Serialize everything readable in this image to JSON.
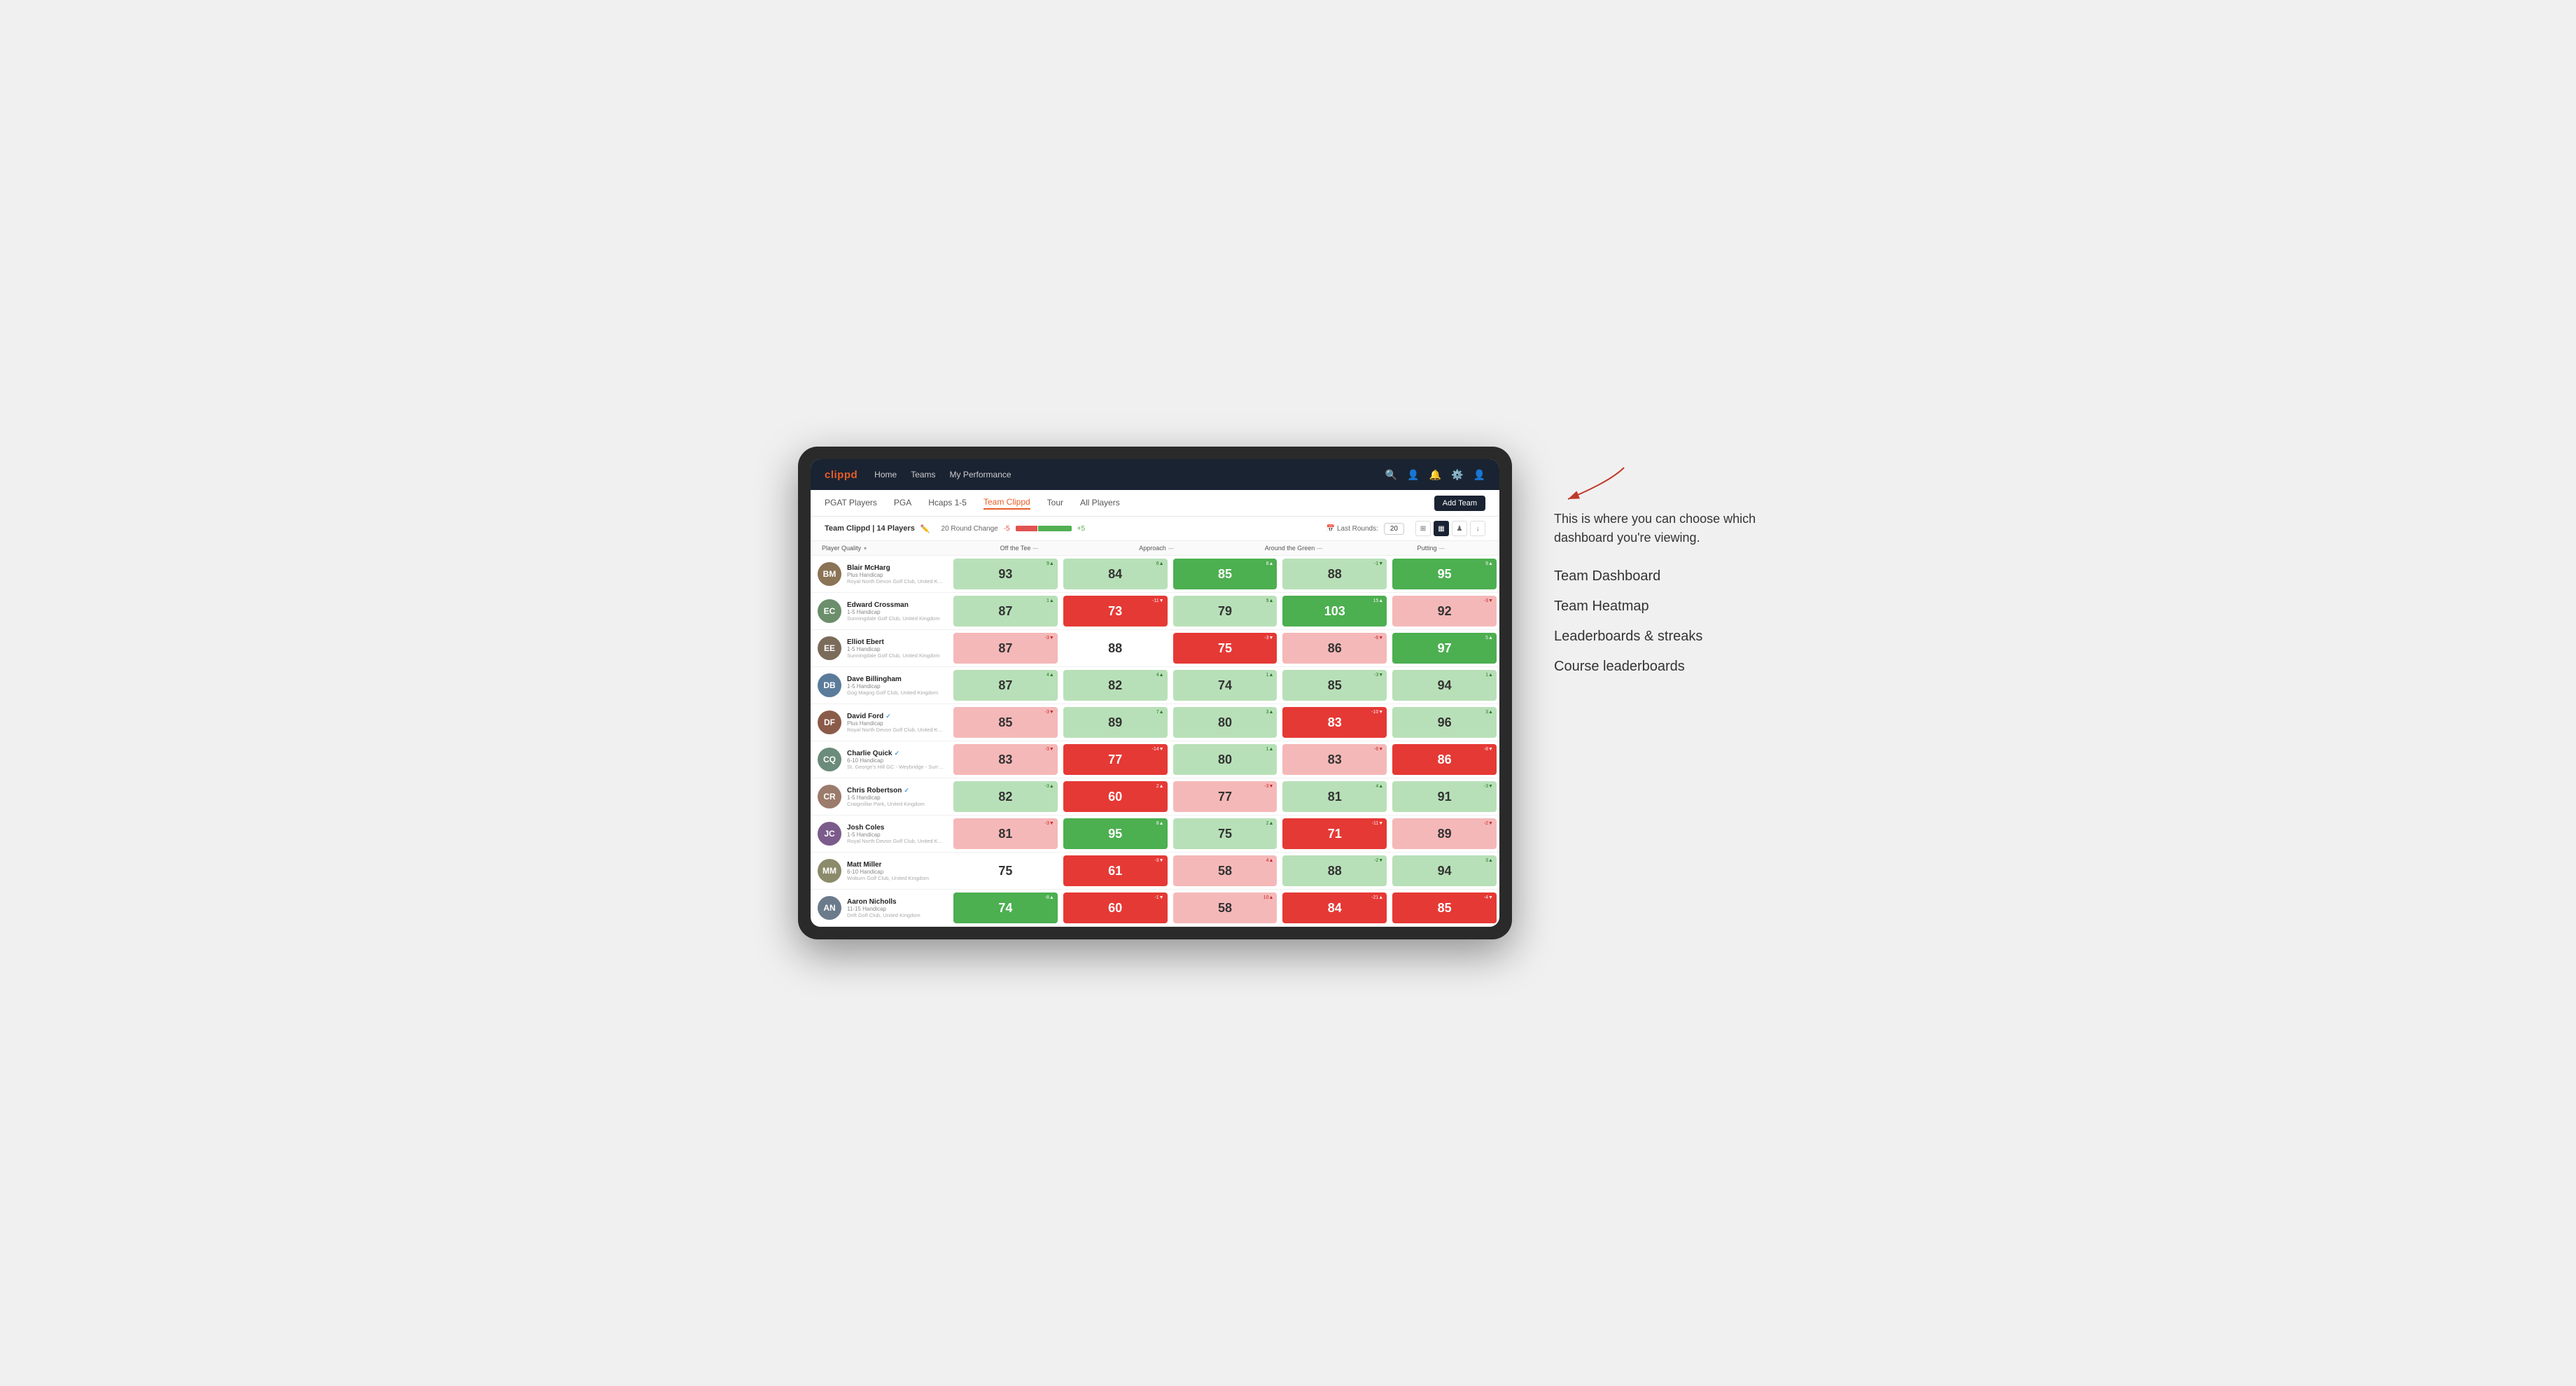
{
  "app": {
    "logo": "clippd",
    "nav_links": [
      "Home",
      "Teams",
      "My Performance"
    ],
    "sub_nav_links": [
      "PGAT Players",
      "PGA",
      "Hcaps 1-5",
      "Team Clippd",
      "Tour",
      "All Players"
    ],
    "active_sub_nav": "Team Clippd",
    "add_team_label": "Add Team"
  },
  "team": {
    "name": "Team Clippd",
    "player_count": "14 Players",
    "round_change_label": "20 Round Change",
    "round_change_neg": "-5",
    "round_change_pos": "+5",
    "last_rounds_label": "Last Rounds:",
    "last_rounds_value": "20"
  },
  "table": {
    "columns": {
      "player_quality": "Player Quality ▾",
      "off_the_tee": "Off the Tee —",
      "approach": "Approach —",
      "around_the_green": "Around the Green —",
      "putting": "Putting —"
    },
    "players": [
      {
        "name": "Blair McHarg",
        "handicap": "Plus Handicap",
        "club": "Royal North Devon Golf Club, United Kingdom",
        "avatar_color": "#8B7355",
        "initials": "BM",
        "scores": [
          {
            "value": "93",
            "change": "9▲",
            "bg": "light-green"
          },
          {
            "value": "84",
            "change": "6▲",
            "bg": "light-green"
          },
          {
            "value": "85",
            "change": "8▲",
            "bg": "green"
          },
          {
            "value": "88",
            "change": "-1▼",
            "bg": "light-green"
          },
          {
            "value": "95",
            "change": "9▲",
            "bg": "green"
          }
        ]
      },
      {
        "name": "Edward Crossman",
        "handicap": "1-5 Handicap",
        "club": "Sunningdale Golf Club, United Kingdom",
        "avatar_color": "#6B8E6B",
        "initials": "EC",
        "scores": [
          {
            "value": "87",
            "change": "1▲",
            "bg": "light-green"
          },
          {
            "value": "73",
            "change": "-11▼",
            "bg": "red"
          },
          {
            "value": "79",
            "change": "9▲",
            "bg": "light-green"
          },
          {
            "value": "103",
            "change": "15▲",
            "bg": "green"
          },
          {
            "value": "92",
            "change": "-3▼",
            "bg": "light-red"
          }
        ]
      },
      {
        "name": "Elliot Ebert",
        "handicap": "1-5 Handicap",
        "club": "Sunningdale Golf Club, United Kingdom",
        "avatar_color": "#7B6B5A",
        "initials": "EE",
        "scores": [
          {
            "value": "87",
            "change": "-3▼",
            "bg": "light-red"
          },
          {
            "value": "88",
            "change": "",
            "bg": "white"
          },
          {
            "value": "75",
            "change": "-3▼",
            "bg": "red"
          },
          {
            "value": "86",
            "change": "-6▼",
            "bg": "light-red"
          },
          {
            "value": "97",
            "change": "5▲",
            "bg": "green"
          }
        ]
      },
      {
        "name": "Dave Billingham",
        "handicap": "1-5 Handicap",
        "club": "Gog Magog Golf Club, United Kingdom",
        "avatar_color": "#5B7B9B",
        "initials": "DB",
        "scores": [
          {
            "value": "87",
            "change": "4▲",
            "bg": "light-green"
          },
          {
            "value": "82",
            "change": "4▲",
            "bg": "light-green"
          },
          {
            "value": "74",
            "change": "1▲",
            "bg": "light-green"
          },
          {
            "value": "85",
            "change": "-3▼",
            "bg": "light-green"
          },
          {
            "value": "94",
            "change": "1▲",
            "bg": "light-green"
          }
        ]
      },
      {
        "name": "David Ford",
        "handicap": "Plus Handicap",
        "club": "Royal North Devon Golf Club, United Kingdom",
        "avatar_color": "#8B5B4A",
        "initials": "DF",
        "verified": true,
        "scores": [
          {
            "value": "85",
            "change": "-3▼",
            "bg": "light-red"
          },
          {
            "value": "89",
            "change": "7▲",
            "bg": "light-green"
          },
          {
            "value": "80",
            "change": "3▲",
            "bg": "light-green"
          },
          {
            "value": "83",
            "change": "-10▼",
            "bg": "red"
          },
          {
            "value": "96",
            "change": "3▲",
            "bg": "light-green"
          }
        ]
      },
      {
        "name": "Charlie Quick",
        "handicap": "6-10 Handicap",
        "club": "St. George's Hill GC - Weybridge - Surrey, Uni...",
        "avatar_color": "#6B8B7B",
        "initials": "CQ",
        "verified": true,
        "scores": [
          {
            "value": "83",
            "change": "-3▼",
            "bg": "light-red"
          },
          {
            "value": "77",
            "change": "-14▼",
            "bg": "red"
          },
          {
            "value": "80",
            "change": "1▲",
            "bg": "light-green"
          },
          {
            "value": "83",
            "change": "-6▼",
            "bg": "light-red"
          },
          {
            "value": "86",
            "change": "-8▼",
            "bg": "red"
          }
        ]
      },
      {
        "name": "Chris Robertson",
        "handicap": "1-5 Handicap",
        "club": "Craigmillar Park, United Kingdom",
        "avatar_color": "#9B7B6B",
        "initials": "CR",
        "verified": true,
        "scores": [
          {
            "value": "82",
            "change": "-3▲",
            "bg": "light-green"
          },
          {
            "value": "60",
            "change": "2▲",
            "bg": "red"
          },
          {
            "value": "77",
            "change": "-3▼",
            "bg": "light-red"
          },
          {
            "value": "81",
            "change": "4▲",
            "bg": "light-green"
          },
          {
            "value": "91",
            "change": "-3▼",
            "bg": "light-green"
          }
        ]
      },
      {
        "name": "Josh Coles",
        "handicap": "1-5 Handicap",
        "club": "Royal North Devon Golf Club, United Kingdom",
        "avatar_color": "#7B5B8B",
        "initials": "JC",
        "scores": [
          {
            "value": "81",
            "change": "-3▼",
            "bg": "light-red"
          },
          {
            "value": "95",
            "change": "8▲",
            "bg": "green"
          },
          {
            "value": "75",
            "change": "2▲",
            "bg": "light-green"
          },
          {
            "value": "71",
            "change": "-11▼",
            "bg": "red"
          },
          {
            "value": "89",
            "change": "-2▼",
            "bg": "light-red"
          }
        ]
      },
      {
        "name": "Matt Miller",
        "handicap": "6-10 Handicap",
        "club": "Woburn Golf Club, United Kingdom",
        "avatar_color": "#8B8B6B",
        "initials": "MM",
        "scores": [
          {
            "value": "75",
            "change": "",
            "bg": "white"
          },
          {
            "value": "61",
            "change": "-3▼",
            "bg": "red"
          },
          {
            "value": "58",
            "change": "4▲",
            "bg": "light-red"
          },
          {
            "value": "88",
            "change": "-2▼",
            "bg": "light-green"
          },
          {
            "value": "94",
            "change": "3▲",
            "bg": "light-green"
          }
        ]
      },
      {
        "name": "Aaron Nicholls",
        "handicap": "11-15 Handicap",
        "club": "Drift Golf Club, United Kingdom",
        "avatar_color": "#6B7B8B",
        "initials": "AN",
        "scores": [
          {
            "value": "74",
            "change": "-8▲",
            "bg": "green"
          },
          {
            "value": "60",
            "change": "-1▼",
            "bg": "red"
          },
          {
            "value": "58",
            "change": "10▲",
            "bg": "light-red"
          },
          {
            "value": "84",
            "change": "-21▲",
            "bg": "red"
          },
          {
            "value": "85",
            "change": "-4▼",
            "bg": "red"
          }
        ]
      }
    ]
  },
  "annotation": {
    "tooltip": "This is where you can choose which dashboard you're viewing.",
    "options": [
      "Team Dashboard",
      "Team Heatmap",
      "Leaderboards & streaks",
      "Course leaderboards"
    ]
  }
}
